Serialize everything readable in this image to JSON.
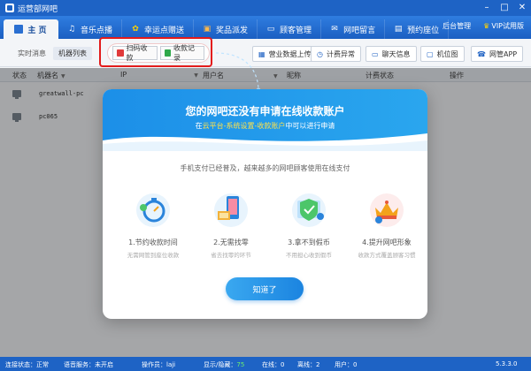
{
  "window": {
    "title": "运营部网吧"
  },
  "nav": {
    "tabs": [
      {
        "label": "主 页",
        "icon": "home-icon"
      },
      {
        "label": "音乐点播",
        "icon": "music-icon"
      },
      {
        "label": "幸运点赠送",
        "icon": "gift-icon"
      },
      {
        "label": "奖品派发",
        "icon": "prize-icon"
      },
      {
        "label": "顾客管理",
        "icon": "customer-icon"
      },
      {
        "label": "网吧留言",
        "icon": "message-icon"
      },
      {
        "label": "预约座位",
        "icon": "seat-icon"
      }
    ],
    "backend": "后台管理",
    "vip": "VIP试用版"
  },
  "toolbar": {
    "subtabs": [
      "实时消息",
      "机器列表"
    ],
    "scan_pay": "扫码收款",
    "pay_record": "收款记录",
    "buttons": [
      "营业数据上传",
      "计费异常",
      "聊天信息",
      "机位图",
      "网管APP"
    ]
  },
  "table": {
    "headers": [
      "状态",
      "机器名",
      "IP",
      "用户名",
      "昵称",
      "计费状态",
      "操作"
    ],
    "rows": [
      {
        "name": "greatwall-pc"
      },
      {
        "name": "pc065"
      }
    ]
  },
  "modal": {
    "title": "您的网吧还没有申请在线收款账户",
    "subtitle_prefix": "在",
    "subtitle_path": "云平台-系统设置-收款账户",
    "subtitle_suffix": "中可以进行申请",
    "description": "手机支付已经普及，越来越多的网吧顾客使用在线支付",
    "features": [
      {
        "title": "1.节约收款时间",
        "sub": "无需网管到座位收款"
      },
      {
        "title": "2.无需找零",
        "sub": "省去找零的环节"
      },
      {
        "title": "3.拿不到假币",
        "sub": "不用担心收到假币"
      },
      {
        "title": "4.提升网吧形象",
        "sub": "收款方式覆盖顾客习惯"
      }
    ],
    "ok_label": "知道了"
  },
  "status": {
    "connection": "连接状态：正常",
    "voice": "语音服务：未开启",
    "operator": "操作员：laji",
    "display_label": "显示/隐藏：",
    "display_value": "75",
    "online": "在线：0",
    "offline": "离线：2",
    "users": "用户：0",
    "version": "5.3.3.0"
  },
  "colors": {
    "brand": "#1e63c5",
    "accent": "#1c8fe8",
    "highlight": "#e31b1b"
  }
}
